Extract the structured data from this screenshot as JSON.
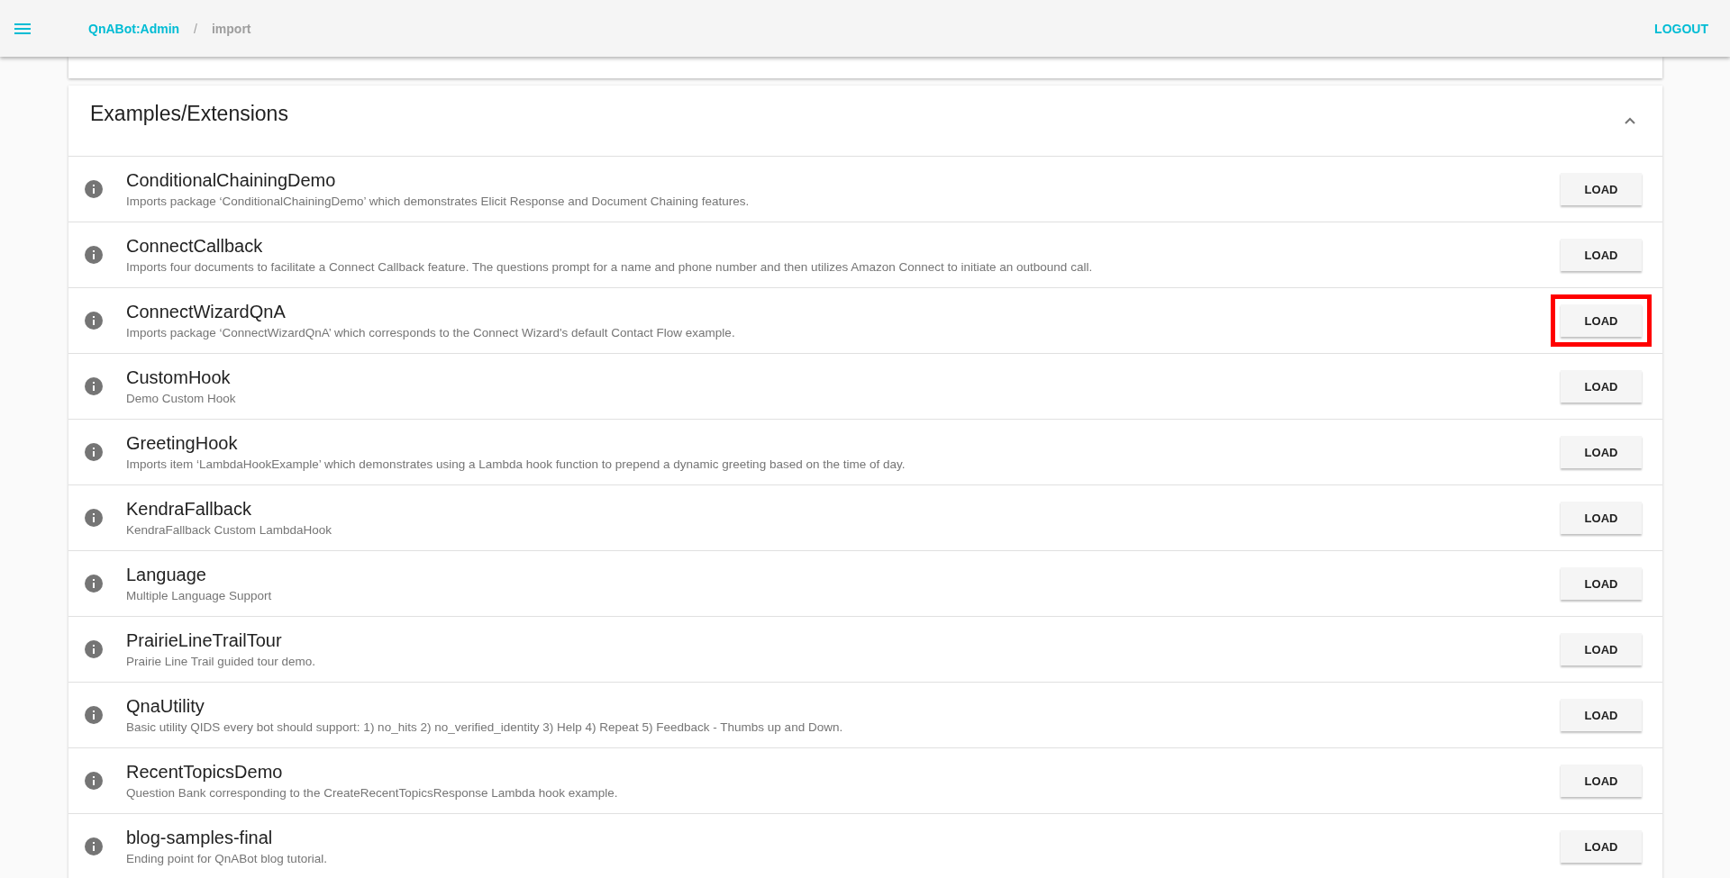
{
  "toolbar": {
    "breadcrumbs": [
      "QnABot:Admin",
      "import"
    ],
    "separator": "/",
    "logout": "LOGOUT"
  },
  "section": {
    "title": "Examples/Extensions",
    "expanded": true,
    "items": [
      {
        "name": "ConditionalChainingDemo",
        "description": "Imports package ‘ConditionalChainingDemo’ which demonstrates Elicit Response and Document Chaining features.",
        "button": "LOAD",
        "highlighted": false
      },
      {
        "name": "ConnectCallback",
        "description": "Imports four documents to facilitate a Connect Callback feature. The questions prompt for a name and phone number and then utilizes Amazon Connect to initiate an outbound call.",
        "button": "LOAD",
        "highlighted": false
      },
      {
        "name": "ConnectWizardQnA",
        "description": "Imports package ‘ConnectWizardQnA’ which corresponds to the Connect Wizard's default Contact Flow example.",
        "button": "LOAD",
        "highlighted": true
      },
      {
        "name": "CustomHook",
        "description": "Demo Custom Hook",
        "button": "LOAD",
        "highlighted": false
      },
      {
        "name": "GreetingHook",
        "description": "Imports item ‘LambdaHookExample’ which demonstrates using a Lambda hook function to prepend a dynamic greeting based on the time of day.",
        "button": "LOAD",
        "highlighted": false
      },
      {
        "name": "KendraFallback",
        "description": "KendraFallback Custom LambdaHook",
        "button": "LOAD",
        "highlighted": false
      },
      {
        "name": "Language",
        "description": "Multiple Language Support",
        "button": "LOAD",
        "highlighted": false
      },
      {
        "name": "PrairieLineTrailTour",
        "description": "Prairie Line Trail guided tour demo.",
        "button": "LOAD",
        "highlighted": false
      },
      {
        "name": "QnaUtility",
        "description": "Basic utility QIDS every bot should support: 1) no_hits 2) no_verified_identity 3) Help 4) Repeat 5) Feedback - Thumbs up and Down.",
        "button": "LOAD",
        "highlighted": false
      },
      {
        "name": "RecentTopicsDemo",
        "description": "Question Bank corresponding to the CreateRecentTopicsResponse Lambda hook example.",
        "button": "LOAD",
        "highlighted": false
      },
      {
        "name": "blog-samples-final",
        "description": "Ending point for QnABot blog tutorial.",
        "button": "LOAD",
        "highlighted": false
      }
    ]
  }
}
